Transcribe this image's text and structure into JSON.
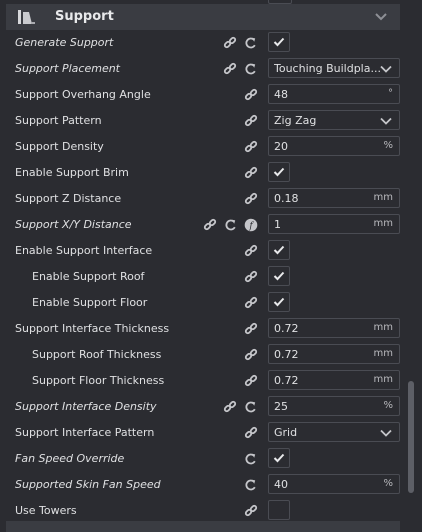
{
  "header": {
    "title": "Support"
  },
  "rows": [
    {
      "label": "Generate Support",
      "italic": true,
      "link": true,
      "reset": true,
      "fn": false,
      "type": "check",
      "checked": true
    },
    {
      "label": "Support Placement",
      "italic": true,
      "link": true,
      "reset": true,
      "fn": false,
      "type": "combo",
      "value": "Touching Buildpla..."
    },
    {
      "label": "Support Overhang Angle",
      "italic": false,
      "link": true,
      "reset": false,
      "fn": false,
      "type": "text",
      "value": "48",
      "unit": "°"
    },
    {
      "label": "Support Pattern",
      "italic": false,
      "link": true,
      "reset": false,
      "fn": false,
      "type": "combo",
      "value": "Zig Zag"
    },
    {
      "label": "Support Density",
      "italic": false,
      "link": true,
      "reset": false,
      "fn": false,
      "type": "text",
      "value": "20",
      "unit": "%"
    },
    {
      "label": "Enable Support Brim",
      "italic": false,
      "link": true,
      "reset": false,
      "fn": false,
      "type": "check",
      "checked": true
    },
    {
      "label": "Support Z Distance",
      "italic": false,
      "link": true,
      "reset": false,
      "fn": false,
      "type": "text",
      "value": "0.18",
      "unit": "mm"
    },
    {
      "label": "Support X/Y Distance",
      "italic": true,
      "link": true,
      "reset": true,
      "fn": true,
      "type": "text",
      "value": "1",
      "unit": "mm"
    },
    {
      "label": "Enable Support Interface",
      "italic": false,
      "link": true,
      "reset": false,
      "fn": false,
      "type": "check",
      "checked": true
    },
    {
      "label": "Enable Support Roof",
      "italic": false,
      "indent": true,
      "link": true,
      "reset": false,
      "fn": false,
      "type": "check",
      "checked": true
    },
    {
      "label": "Enable Support Floor",
      "italic": false,
      "indent": true,
      "link": true,
      "reset": false,
      "fn": false,
      "type": "check",
      "checked": true
    },
    {
      "label": "Support Interface Thickness",
      "italic": false,
      "link": true,
      "reset": false,
      "fn": false,
      "type": "text",
      "value": "0.72",
      "unit": "mm"
    },
    {
      "label": "Support Roof Thickness",
      "italic": false,
      "indent": true,
      "link": true,
      "reset": false,
      "fn": false,
      "type": "text",
      "value": "0.72",
      "unit": "mm"
    },
    {
      "label": "Support Floor Thickness",
      "italic": false,
      "indent": true,
      "link": true,
      "reset": false,
      "fn": false,
      "type": "text",
      "value": "0.72",
      "unit": "mm"
    },
    {
      "label": "Support Interface Density",
      "italic": true,
      "link": true,
      "reset": true,
      "fn": false,
      "type": "text",
      "value": "25",
      "unit": "%"
    },
    {
      "label": "Support Interface Pattern",
      "italic": false,
      "link": true,
      "reset": false,
      "fn": false,
      "type": "combo",
      "value": "Grid"
    },
    {
      "label": "Fan Speed Override",
      "italic": true,
      "link": false,
      "reset": true,
      "fn": false,
      "type": "check",
      "checked": true
    },
    {
      "label": "Supported Skin Fan Speed",
      "italic": true,
      "link": false,
      "reset": true,
      "fn": false,
      "type": "text",
      "value": "40",
      "unit": "%"
    },
    {
      "label": "Use Towers",
      "italic": false,
      "link": true,
      "reset": false,
      "fn": false,
      "type": "check",
      "checked": false
    }
  ],
  "icons": {
    "link": "link-icon",
    "reset": "reset-icon",
    "function": "function-icon",
    "check": "checkmark-icon",
    "dropdown": "chevron-down-icon",
    "section": "support-icon"
  },
  "colors": {
    "background": "#2b2c31",
    "header": "#3a3c42",
    "border": "#4a4c53",
    "text": "#dfe0e2",
    "icon": "#c5c6ca"
  }
}
